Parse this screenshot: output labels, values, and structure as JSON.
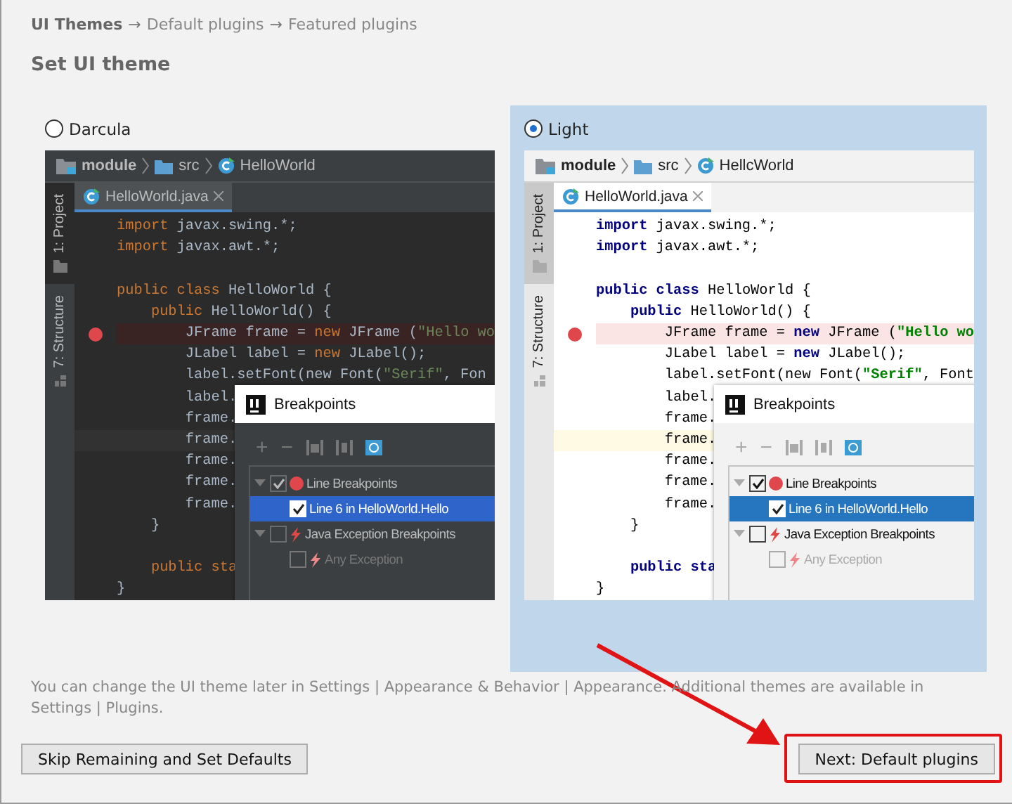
{
  "steps": [
    {
      "label": "UI Themes",
      "selected": true
    },
    {
      "label": "Default plugins",
      "selected": false
    },
    {
      "label": "Featured plugins",
      "selected": false
    }
  ],
  "step_separator": "→",
  "heading": "Set UI theme",
  "themes": [
    {
      "kind": "dark",
      "label": "Darcula",
      "selected": false,
      "preview": {
        "crumbs": [
          {
            "kind": "module",
            "text": "module"
          },
          {
            "kind": "folder",
            "text": "src"
          },
          {
            "kind": "class",
            "text": "HelloWorld"
          }
        ],
        "tool_tabs": [
          {
            "kind": "folder",
            "label": "1: Project",
            "selected": true
          },
          {
            "kind": "structure",
            "label": "7: Structure",
            "selected": false
          }
        ],
        "file_tab": "HelloWorld.java",
        "code": [
          {
            "kind": "code",
            "tokens": [
              {
                "kind": "kw",
                "text": "import"
              },
              {
                "kind": "plain",
                "text": " javax.swing.*;"
              }
            ]
          },
          {
            "kind": "code",
            "tokens": [
              {
                "kind": "kw",
                "text": "import"
              },
              {
                "kind": "plain",
                "text": " javax.awt.*;"
              }
            ]
          },
          {
            "kind": "blank"
          },
          {
            "kind": "code",
            "tokens": [
              {
                "kind": "kw",
                "text": "public class"
              },
              {
                "kind": "plain",
                "text": " HelloWorld {"
              }
            ]
          },
          {
            "kind": "code",
            "tokens": [
              {
                "kind": "kw",
                "text": "    public"
              },
              {
                "kind": "plain",
                "text": " HelloWorld() {"
              }
            ]
          },
          {
            "kind": "breakpoint",
            "tokens": [
              {
                "kind": "plain",
                "text": "        JFrame frame = "
              },
              {
                "kind": "kw",
                "text": "new"
              },
              {
                "kind": "plain",
                "text": " JFrame ("
              },
              {
                "kind": "str",
                "text": "\"Hello wo"
              }
            ]
          },
          {
            "kind": "code",
            "tokens": [
              {
                "kind": "plain",
                "text": "        JLabel label = "
              },
              {
                "kind": "kw",
                "text": "new"
              },
              {
                "kind": "plain",
                "text": " JLabel();"
              }
            ]
          },
          {
            "kind": "code",
            "tokens": [
              {
                "kind": "plain",
                "text": "        label.setFont(new Font("
              },
              {
                "kind": "str",
                "text": "\"Serif\""
              },
              {
                "kind": "plain",
                "text": ", Fon"
              }
            ]
          },
          {
            "kind": "code",
            "tokens": [
              {
                "kind": "plain",
                "text": "        label."
              }
            ]
          },
          {
            "kind": "code",
            "tokens": [
              {
                "kind": "plain",
                "text": "        frame."
              }
            ]
          },
          {
            "kind": "current",
            "tokens": [
              {
                "kind": "plain",
                "text": "        frame."
              }
            ]
          },
          {
            "kind": "code",
            "tokens": [
              {
                "kind": "plain",
                "text": "        frame."
              }
            ]
          },
          {
            "kind": "code",
            "tokens": [
              {
                "kind": "plain",
                "text": "        frame."
              }
            ]
          },
          {
            "kind": "code",
            "tokens": [
              {
                "kind": "plain",
                "text": "        frame."
              }
            ]
          },
          {
            "kind": "code",
            "tokens": [
              {
                "kind": "plain",
                "text": "    }"
              }
            ]
          },
          {
            "kind": "blank"
          },
          {
            "kind": "code",
            "tokens": [
              {
                "kind": "kw",
                "text": "    public sta"
              }
            ]
          },
          {
            "kind": "code",
            "tokens": [
              {
                "kind": "plain",
                "text": "}"
              }
            ]
          }
        ],
        "dialog": {
          "title": "Breakpoints",
          "tools": [
            "+",
            "−"
          ],
          "tree": [
            {
              "kind": "line",
              "label": "Line Breakpoints",
              "expanded": true,
              "checked": true,
              "selected": false,
              "disabled": false,
              "children": [
                {
                  "kind": "item",
                  "label": "Line 6 in HelloWorld.Hello",
                  "checked": true,
                  "selected": true,
                  "disabled": false
                }
              ]
            },
            {
              "kind": "exception",
              "label": "Java Exception Breakpoints",
              "expanded": true,
              "checked": false,
              "selected": false,
              "disabled": false,
              "children": [
                {
                  "kind": "exception",
                  "label": "Any Exception",
                  "checked": false,
                  "selected": false,
                  "disabled": true
                }
              ]
            }
          ]
        }
      }
    },
    {
      "kind": "light",
      "label": "Light",
      "selected": true,
      "preview": {
        "crumbs": [
          {
            "kind": "module",
            "text": "module"
          },
          {
            "kind": "folder",
            "text": "src"
          },
          {
            "kind": "class",
            "text": "HellcWorld"
          }
        ],
        "tool_tabs": [
          {
            "kind": "folder",
            "label": "1: Project",
            "selected": true
          },
          {
            "kind": "structure",
            "label": "7: Structure",
            "selected": false
          }
        ],
        "file_tab": "HelloWorld.java",
        "code": [
          {
            "kind": "code",
            "tokens": [
              {
                "kind": "kw",
                "text": "import"
              },
              {
                "kind": "plain",
                "text": " javax.swing.*;"
              }
            ]
          },
          {
            "kind": "code",
            "tokens": [
              {
                "kind": "kw",
                "text": "import"
              },
              {
                "kind": "plain",
                "text": " javax.awt.*;"
              }
            ]
          },
          {
            "kind": "blank"
          },
          {
            "kind": "code",
            "tokens": [
              {
                "kind": "kw",
                "text": "public class"
              },
              {
                "kind": "plain",
                "text": " HelloWorld {"
              }
            ]
          },
          {
            "kind": "code",
            "tokens": [
              {
                "kind": "kw",
                "text": "    public"
              },
              {
                "kind": "plain",
                "text": " HelloWorld() {"
              }
            ]
          },
          {
            "kind": "breakpoint",
            "tokens": [
              {
                "kind": "plain",
                "text": "        JFrame frame = "
              },
              {
                "kind": "kw",
                "text": "new"
              },
              {
                "kind": "plain",
                "text": " JFrame ("
              },
              {
                "kind": "str",
                "text": "\"Hello wo"
              }
            ]
          },
          {
            "kind": "code",
            "tokens": [
              {
                "kind": "plain",
                "text": "        JLabel label = "
              },
              {
                "kind": "kw",
                "text": "new"
              },
              {
                "kind": "plain",
                "text": " JLabel();"
              }
            ]
          },
          {
            "kind": "code",
            "tokens": [
              {
                "kind": "plain",
                "text": "        label.setFont(new Font("
              },
              {
                "kind": "str",
                "text": "\"Serif\""
              },
              {
                "kind": "plain",
                "text": ", Font"
              }
            ]
          },
          {
            "kind": "code",
            "tokens": [
              {
                "kind": "plain",
                "text": "        label."
              }
            ]
          },
          {
            "kind": "code",
            "tokens": [
              {
                "kind": "plain",
                "text": "        frame."
              }
            ]
          },
          {
            "kind": "current",
            "tokens": [
              {
                "kind": "plain",
                "text": "        frame."
              }
            ]
          },
          {
            "kind": "code",
            "tokens": [
              {
                "kind": "plain",
                "text": "        frame."
              }
            ]
          },
          {
            "kind": "code",
            "tokens": [
              {
                "kind": "plain",
                "text": "        frame."
              }
            ]
          },
          {
            "kind": "code",
            "tokens": [
              {
                "kind": "plain",
                "text": "        frame."
              }
            ]
          },
          {
            "kind": "code",
            "tokens": [
              {
                "kind": "plain",
                "text": "    }"
              }
            ]
          },
          {
            "kind": "blank"
          },
          {
            "kind": "code",
            "tokens": [
              {
                "kind": "kw",
                "text": "    public sta"
              }
            ]
          },
          {
            "kind": "code",
            "tokens": [
              {
                "kind": "plain",
                "text": "}"
              }
            ]
          }
        ],
        "dialog": {
          "title": "Breakpoints",
          "tools": [
            "+",
            "−"
          ],
          "tree": [
            {
              "kind": "line",
              "label": "Line Breakpoints",
              "expanded": true,
              "checked": true,
              "selected": false,
              "disabled": false,
              "children": [
                {
                  "kind": "item",
                  "label": "Line 6 in HelloWorld.Hello",
                  "checked": true,
                  "selected": true,
                  "disabled": false
                }
              ]
            },
            {
              "kind": "exception",
              "label": "Java Exception Breakpoints",
              "expanded": true,
              "checked": false,
              "selected": false,
              "disabled": false,
              "children": [
                {
                  "kind": "exception",
                  "label": "Any Exception",
                  "checked": false,
                  "selected": false,
                  "disabled": true
                }
              ]
            }
          ]
        }
      }
    }
  ],
  "note": "You can change the UI theme later in Settings | Appearance & Behavior | Appearance. Additional themes are available in Settings | Plugins.",
  "buttons": [
    {
      "label": "Skip Remaining and Set Defaults",
      "highlighted": false
    },
    {
      "label": "Next: Default plugins",
      "highlighted": true
    }
  ]
}
